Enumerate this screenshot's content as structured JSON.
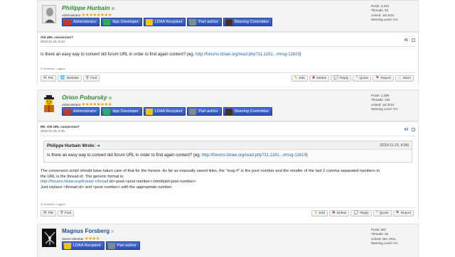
{
  "posts": [
    {
      "author": "Philippe Hurbain",
      "author_status": "online",
      "role": "Administrator",
      "stars": "★★★★★★★★",
      "badges": [
        "Administrator",
        "App Developer",
        "LDAA Recipient",
        "Part author",
        "Steering Committee"
      ],
      "stats": {
        "posts": "Posts: 2,242",
        "threads": "Threads: 93",
        "joined": "Joined: Jul 2011",
        "warning_label": "Warning Level:",
        "warning_value": "0%"
      },
      "subject": "Old URL conversion?",
      "date": "2016-11-15, 6:34",
      "number": "#1",
      "text_before": "Is there an easy way to convert old forum URL in order to find again content? (eg. ",
      "link": "http://forums.ldraw.org/read.php?11,1161...#msg-11619",
      "text_after": ")",
      "ip": "IP Address: Logged",
      "left_buttons": [
        "PM",
        "Website",
        "Find"
      ],
      "right_buttons": [
        "Edit",
        "Delete",
        "Reply",
        "Quote",
        "Report",
        "Warn"
      ]
    },
    {
      "author": "Orion Pobursky",
      "author_status": "online",
      "role": "Administrator",
      "stars": "★★★★★★★★",
      "badges": [
        "Administrator",
        "App Developer",
        "LDAA Recipient",
        "Part author",
        "Steering Committee"
      ],
      "stats": {
        "posts": "Posts: 1,399",
        "threads": "Threads: 192",
        "joined": "Joined: Jul 2011",
        "warning_label": "Warning Level:",
        "warning_value": "0%"
      },
      "subject": "RE: Old URL conversion?",
      "date": "2016-11-15, 6:45",
      "number": "#3",
      "quote": {
        "author": "Philippe Hurbain Wrote:",
        "arrow": "➜",
        "date": "(2016-11-15, 6:34)",
        "text_before": "Is there an easy way to convert old forum URL in order to find again content? (eg. ",
        "link": "http://forums.ldraw.org/read.php?11,1161...#msg-11619",
        "text_after": ")"
      },
      "paragraph_1": "The conversion script should have taken care of that for the forums. As far as manually saved links, the \"msg-#\" is the post number and the smaller of the last 2 comma separated numbers in",
      "paragraph_2": "the URL is the thread id. The generic format is:",
      "format_link": "http://forums.ldraw.org/thread-<thread",
      "format_rest": " id>-post-<post number>.html#pid<post number>",
      "paragraph_3": "Just replace <thread id> and <post number> with the appropriate number.",
      "ip": "IP Address: Logged",
      "left_buttons": [
        "PM",
        "Find"
      ],
      "right_buttons": [
        "Edit",
        "Delete",
        "Reply",
        "Quote",
        "Report"
      ]
    },
    {
      "author": "Magnus Forsberg",
      "author_status": "offline",
      "role": "Senior Member",
      "stars": "★★★★",
      "badges": [
        "LDAA Recipient",
        "Part author"
      ],
      "stats": {
        "posts": "Posts: 557",
        "threads": "Threads: 26",
        "joined": "Joined: Dec 2011",
        "warning_label": "Warning Level:",
        "warning_value": "0%"
      }
    }
  ],
  "colors": {
    "accent_link": "#1f66b3",
    "badge_blue": "#2b4fb3",
    "username_green": "#2f8a2f",
    "username_blue": "#1f4f8b",
    "star_gold": "#e8a400"
  }
}
